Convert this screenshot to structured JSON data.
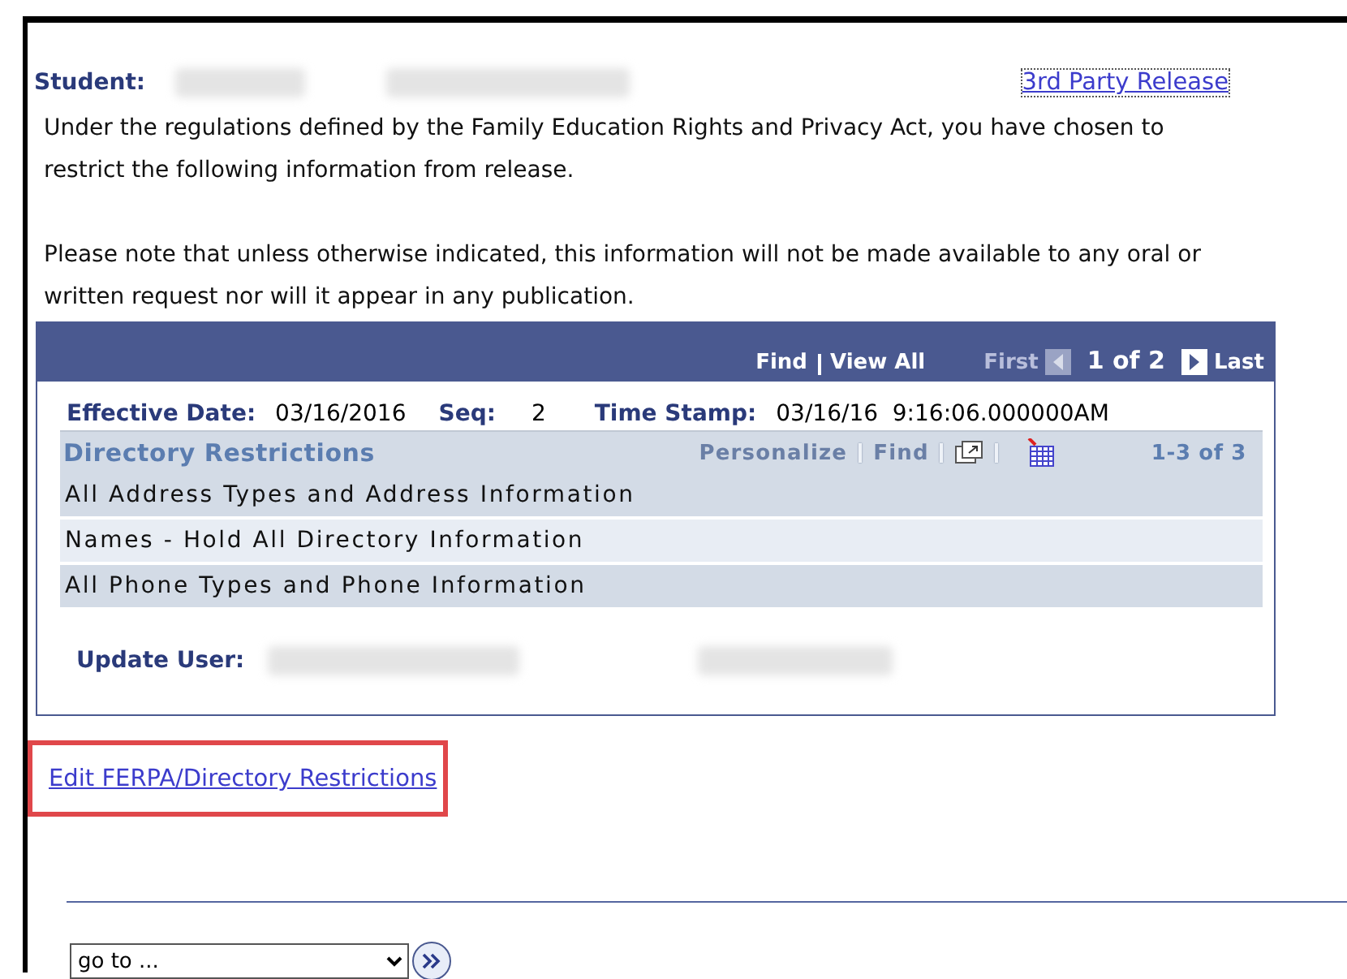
{
  "student": {
    "label": "Student:"
  },
  "third_party_link": "3rd Party Release",
  "paragraphs": [
    "Under the regulations defined by the Family Education Rights and Privacy Act, you have chosen to restrict the following information from release.",
    "Please note that unless otherwise indicated, this information will not be made available to any oral or written request nor will it appear in any publication."
  ],
  "nav": {
    "find": "Find",
    "view_all": "View All",
    "first": "First",
    "position": "1 of 2",
    "last": "Last"
  },
  "record": {
    "effective_date_label": "Effective Date:",
    "effective_date": "03/16/2016",
    "seq_label": "Seq:",
    "seq": "2",
    "time_stamp_label": "Time Stamp:",
    "time_stamp": "03/16/16  9:16:06.000000AM"
  },
  "grid": {
    "title": "Directory Restrictions",
    "personalize": "Personalize",
    "find": "Find",
    "count": "1-3 of 3",
    "rows": [
      "All Address Types and Address Information",
      "Names - Hold All Directory Information",
      "All Phone Types and Phone Information"
    ]
  },
  "update_user": {
    "label": "Update User:"
  },
  "edit_link": {
    "text": "Edit FERPA/Directory Restrictions",
    "highlighted": true
  },
  "goto": {
    "value": "go to ..."
  }
}
